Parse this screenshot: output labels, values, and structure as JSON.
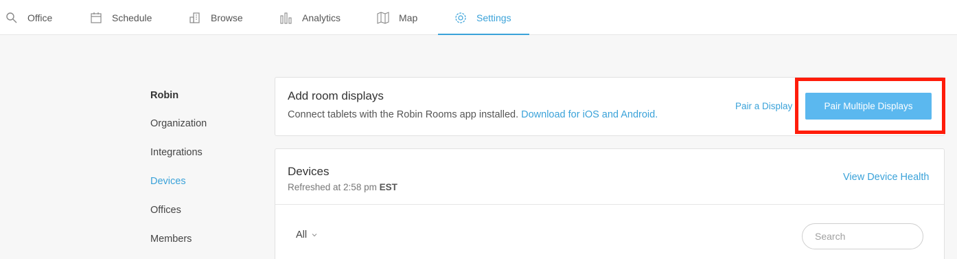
{
  "nav": {
    "items": [
      {
        "label": "Office",
        "icon": "search-icon"
      },
      {
        "label": "Schedule",
        "icon": "calendar-icon"
      },
      {
        "label": "Browse",
        "icon": "building-icon"
      },
      {
        "label": "Analytics",
        "icon": "bar-chart-icon"
      },
      {
        "label": "Map",
        "icon": "map-icon"
      },
      {
        "label": "Settings",
        "icon": "gear-icon",
        "active": true
      }
    ]
  },
  "sidebar": {
    "items": [
      {
        "label": "Robin"
      },
      {
        "label": "Organization"
      },
      {
        "label": "Integrations"
      },
      {
        "label": "Devices",
        "active": true
      },
      {
        "label": "Offices"
      },
      {
        "label": "Members"
      }
    ]
  },
  "room_displays": {
    "title": "Add room displays",
    "description": "Connect tablets with the Robin Rooms app installed.",
    "download_link": "Download for iOS and Android.",
    "pair_link": "Pair a Display",
    "pair_multiple_button": "Pair Multiple Displays"
  },
  "devices": {
    "title": "Devices",
    "refreshed_prefix": "Refreshed at 2:58 pm",
    "refreshed_tz": "EST",
    "health_link": "View Device Health",
    "filter_value": "All",
    "search_placeholder": "Search"
  },
  "colors": {
    "accent": "#3aa2d9",
    "button": "#5bb8ef",
    "highlight": "#ff1c0a"
  }
}
